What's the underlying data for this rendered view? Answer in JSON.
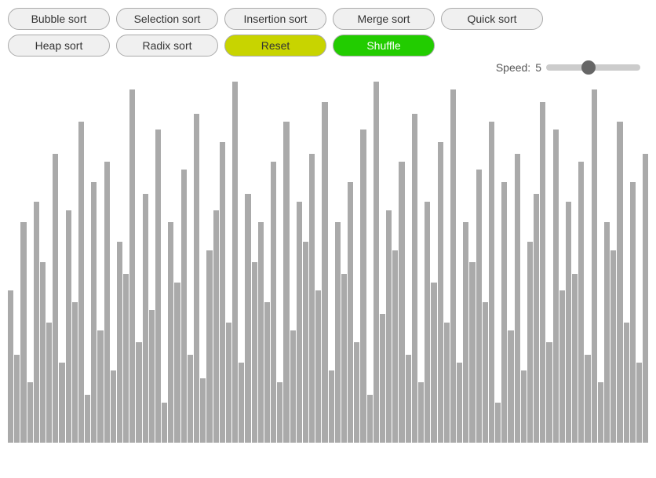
{
  "buttons": {
    "bubble_sort": "Bubble sort",
    "selection_sort": "Selection sort",
    "insertion_sort": "Insertion sort",
    "merge_sort": "Merge sort",
    "quick_sort": "Quick sort",
    "heap_sort": "Heap sort",
    "radix_sort": "Radix sort",
    "reset": "Reset",
    "shuffle": "Shuffle"
  },
  "speed": {
    "label": "Speed:",
    "value": 5
  },
  "bars": [
    38,
    22,
    55,
    15,
    60,
    45,
    30,
    72,
    20,
    58,
    35,
    80,
    12,
    65,
    28,
    70,
    18,
    50,
    42,
    88,
    25,
    62,
    33,
    78,
    10,
    55,
    40,
    68,
    22,
    82,
    16,
    48,
    58,
    75,
    30,
    90,
    20,
    62,
    45,
    55,
    35,
    70,
    15,
    80,
    28,
    60,
    50,
    72,
    38,
    85,
    18,
    55,
    42,
    65,
    25,
    78,
    12,
    90,
    32,
    58,
    48,
    70,
    22,
    82,
    15,
    60,
    40,
    75,
    30,
    88,
    20,
    55,
    45,
    68,
    35,
    80,
    10,
    65,
    28,
    72,
    18,
    50,
    62,
    85,
    25,
    78,
    38,
    60,
    42,
    70,
    22,
    88,
    15,
    55,
    48,
    80,
    30,
    65,
    20,
    72
  ]
}
